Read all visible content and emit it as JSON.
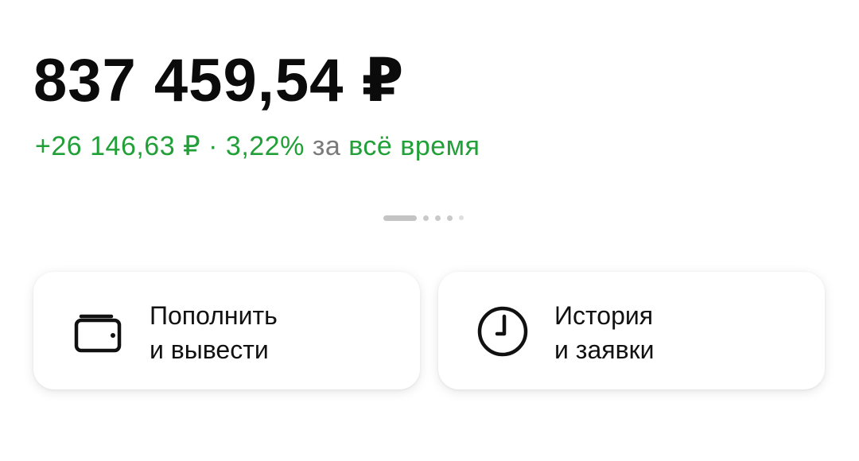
{
  "balance": {
    "amount": "837 459,54 ₽"
  },
  "profit": {
    "value": "+26 146,63 ₽",
    "separator": " · ",
    "percent": "3,22%",
    "period_prefix": "за",
    "period_link": "всё время"
  },
  "pager": {
    "pages": 5,
    "active_index": 0
  },
  "actions": [
    {
      "icon": "wallet-icon",
      "line1": "Пополнить",
      "line2": "и вывести"
    },
    {
      "icon": "clock-icon",
      "line1": "История",
      "line2": "и заявки"
    }
  ],
  "colors": {
    "accent_green": "#21a038",
    "text_primary": "#0b0b0b",
    "text_secondary": "#7a7a7a"
  }
}
